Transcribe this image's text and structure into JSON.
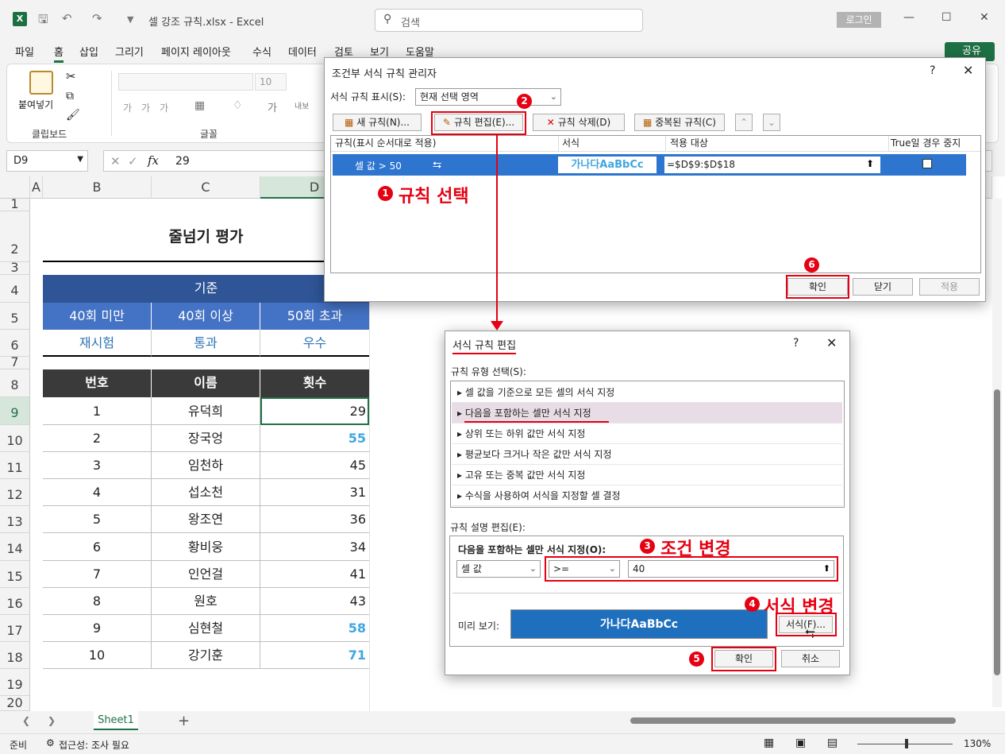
{
  "app": {
    "file_title": "셀 강조 규칙.xlsx  -  Excel",
    "search_placeholder": "검색",
    "login": "로그인",
    "share": "공유"
  },
  "menu": [
    "파일",
    "홈",
    "삽입",
    "그리기",
    "페이지 레이아웃",
    "수식",
    "데이터",
    "검토",
    "보기",
    "도움말"
  ],
  "ribbon": {
    "paste": "붙여넣기",
    "clipboard": "클립보드",
    "font_group": "글꼴",
    "font_size": "10",
    "wrap": "내보"
  },
  "formula_bar": {
    "name_box": "D9",
    "fx": "fx",
    "value": "29"
  },
  "columns": [
    "A",
    "B",
    "C",
    "D"
  ],
  "rows": [
    "1",
    "2",
    "3",
    "4",
    "5",
    "6",
    "7",
    "8",
    "9",
    "10",
    "11",
    "12",
    "13",
    "14",
    "15",
    "16",
    "17",
    "18",
    "19",
    "20"
  ],
  "sheet": {
    "title": "줄넘기 평가",
    "criteria_header": "기준",
    "criteria_ranges": [
      "40회 미만",
      "40회 이상",
      "50회 초과"
    ],
    "criteria_grades": [
      "재시험",
      "통과",
      "우수"
    ],
    "table_headers": [
      "번호",
      "이름",
      "횟수"
    ],
    "records": [
      {
        "no": "1",
        "name": "유덕희",
        "count": "29"
      },
      {
        "no": "2",
        "name": "장국엉",
        "count": "55"
      },
      {
        "no": "3",
        "name": "임천하",
        "count": "45"
      },
      {
        "no": "4",
        "name": "섭소천",
        "count": "31"
      },
      {
        "no": "5",
        "name": "왕조연",
        "count": "36"
      },
      {
        "no": "6",
        "name": "황비웅",
        "count": "34"
      },
      {
        "no": "7",
        "name": "인언걸",
        "count": "41"
      },
      {
        "no": "8",
        "name": "원호",
        "count": "43"
      },
      {
        "no": "9",
        "name": "심현철",
        "count": "58"
      },
      {
        "no": "10",
        "name": "강기훈",
        "count": "71"
      }
    ],
    "tab": "Sheet1"
  },
  "status": {
    "ready": "준비",
    "accessibility": "접근성: 조사 필요",
    "zoom": "130%"
  },
  "manager": {
    "title": "조건부 서식 규칙 관리자",
    "show_label": "서식 규칙 표시(S):",
    "show_value": "현재 선택 영역",
    "btn_new": "새 규칙(N)...",
    "btn_edit": "규칙 편집(E)...",
    "btn_delete": "규칙 삭제(D)",
    "btn_dup": "중복된 규칙(C)",
    "col_rule": "규칙(표시 순서대로 적용)",
    "col_format": "서식",
    "col_applies": "적용 대상",
    "col_stop": "True일 경우 중지",
    "rule_text": "셀 값 > 50",
    "rule_preview": "가나다AaBbCc",
    "rule_range": "=$D$9:$D$18",
    "ok": "확인",
    "close": "닫기",
    "apply": "적용"
  },
  "editor": {
    "title": "서식 규칙 편집",
    "type_label": "규칙 유형 선택(S):",
    "types": [
      "셀 값을 기준으로 모든 셀의 서식 지정",
      "다음을 포함하는 셀만 서식 지정",
      "상위 또는 하위 값만 서식 지정",
      "평균보다 크거나 작은 값만 서식 지정",
      "고유 또는 중복 값만 서식 지정",
      "수식을 사용하여 서식을 지정할 셀 결정"
    ],
    "desc_label": "규칙 설명 편집(E):",
    "desc_heading": "다음을 포함하는 셀만 서식 지정(O):",
    "cond_field": "셀 값",
    "cond_op": ">=",
    "cond_value": "40",
    "preview_label": "미리 보기:",
    "preview_text": "가나다AaBbCc",
    "format_btn": "서식(F)...",
    "ok": "확인",
    "cancel": "취소"
  },
  "annotations": {
    "n1": "1",
    "t1": "규칙 선택",
    "n2": "2",
    "n3": "3",
    "t3": "조건 변경",
    "n4": "4",
    "t4": "서식 변경",
    "n5": "5",
    "n6": "6"
  },
  "colors": {
    "header_dark_blue": "#2f5597",
    "header_mid_blue": "#4472c4",
    "table_header": "#3a3a3a",
    "highlight_text": "#3fa6e0",
    "preview_bg": "#1f6fbf",
    "excel_green": "#1e7145",
    "annotation_red": "#e60012"
  }
}
